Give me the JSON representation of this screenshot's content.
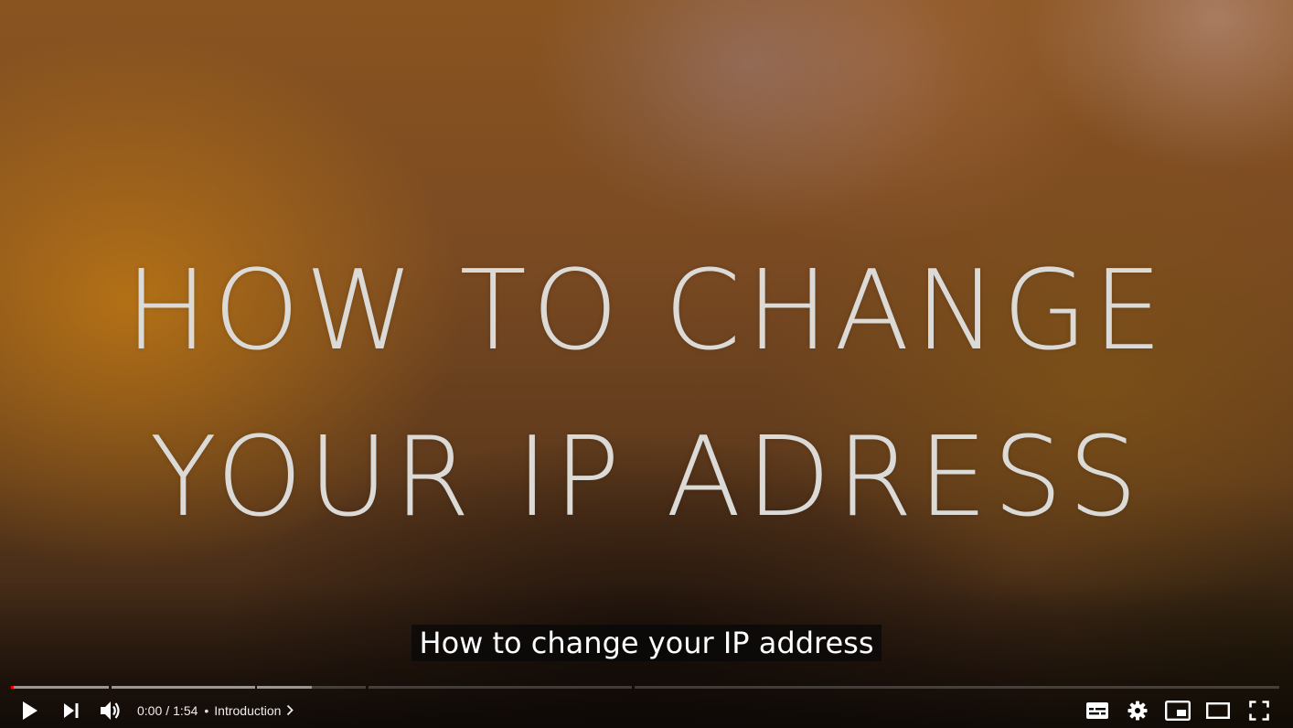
{
  "video": {
    "title_lines": [
      "HOW TO CHANGE",
      "YOUR IP ADRESS"
    ],
    "caption": "How to change your IP address"
  },
  "player": {
    "current_time": "0:00",
    "time_separator": "/",
    "duration": "1:54",
    "chapter_separator": "•",
    "chapter_title": "Introduction",
    "progress_fraction": 0.0,
    "chapters": [
      {
        "start_fraction": 0.0,
        "end_fraction": 0.077,
        "loaded_fraction": 1.0
      },
      {
        "start_fraction": 0.079,
        "end_fraction": 0.192,
        "loaded_fraction": 1.0
      },
      {
        "start_fraction": 0.194,
        "end_fraction": 0.28,
        "loaded_fraction": 0.5
      },
      {
        "start_fraction": 0.282,
        "end_fraction": 0.49,
        "loaded_fraction": 0.0
      },
      {
        "start_fraction": 0.492,
        "end_fraction": 1.0,
        "loaded_fraction": 0.0
      }
    ]
  },
  "controls": {
    "left": [
      "play-icon",
      "next-icon",
      "volume-icon"
    ],
    "right": [
      "subtitles-icon",
      "settings-gear-icon",
      "miniplayer-icon",
      "theater-mode-icon",
      "fullscreen-icon"
    ]
  },
  "colors": {
    "accent": "#ff0000",
    "control_icon": "#ffffff",
    "caption_bg": "#080808"
  }
}
